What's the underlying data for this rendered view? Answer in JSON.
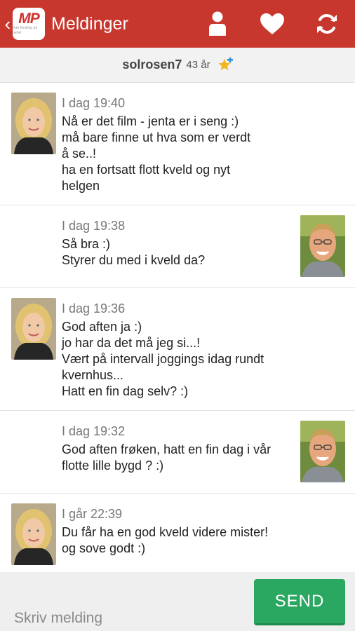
{
  "header": {
    "back_glyph": "‹",
    "logo_text": "MP",
    "logo_tagline": "Vær forsiktig på nettet",
    "title": "Meldinger",
    "icons": [
      "person-icon",
      "heart-icon",
      "refresh-icon"
    ]
  },
  "partner": {
    "username": "solrosen7",
    "age": "43 år",
    "badge_icon": "star-plus-icon"
  },
  "messages": [
    {
      "from": "partner",
      "time": "I dag 19:40",
      "text": "Nå er det film - jenta er i seng :)\nmå bare finne ut hva som er verdt\nå se..!\nha en fortsatt flott kveld og nyt\nhelgen"
    },
    {
      "from": "me",
      "time": "I dag 19:38",
      "text": "Så bra :)\nStyrer du med i kveld da?"
    },
    {
      "from": "partner",
      "time": "I dag 19:36",
      "text": "God aften ja :)\njo har da det må jeg si...!\nVært på intervall joggings idag rundt\nkvernhus...\nHatt en fin dag selv? :)"
    },
    {
      "from": "me",
      "time": "I dag 19:32",
      "text": "God aften frøken, hatt en fin dag i vår\nflotte lille bygd ? :)"
    },
    {
      "from": "partner",
      "time": "I går 22:39",
      "text": "Du får ha en god kveld videre mister!\nog sove godt :)"
    }
  ],
  "composer": {
    "placeholder": "Skriv melding",
    "value": "",
    "send_label": "SEND"
  },
  "colors": {
    "header": "#c8372d",
    "send": "#2aa760",
    "input_underline": "#2a8fc9"
  }
}
